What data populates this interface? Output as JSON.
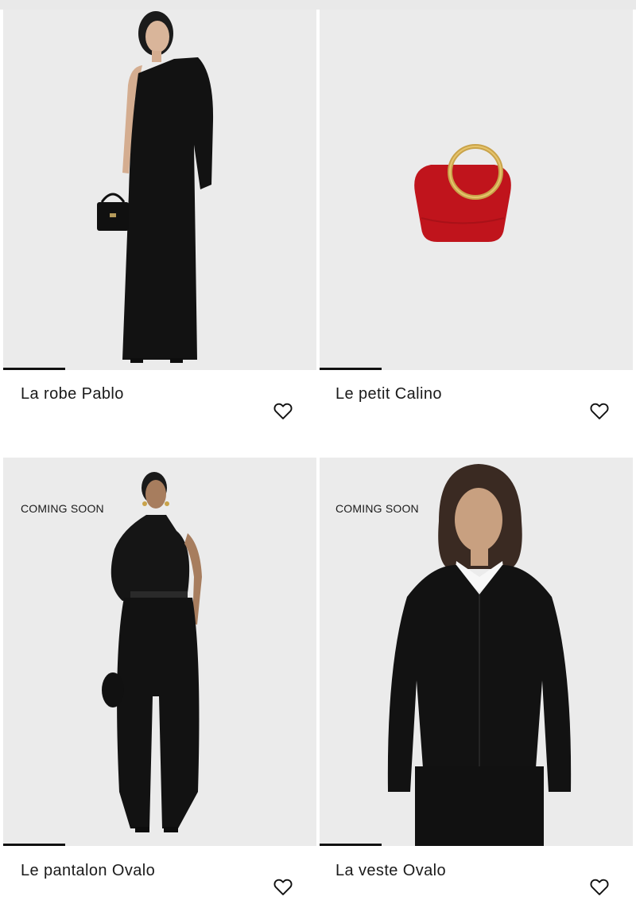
{
  "products": [
    {
      "name": "La robe Pablo",
      "badge": "",
      "image": "model-black-one-shoulder-dress"
    },
    {
      "name": "Le petit Calino",
      "badge": "",
      "image": "red-round-handle-handbag"
    },
    {
      "name": "Le pantalon Ovalo",
      "badge": "COMING SOON",
      "image": "model-black-draped-top-trousers"
    },
    {
      "name": "La veste Ovalo",
      "badge": "COMING SOON",
      "image": "model-black-sculpted-jacket"
    }
  ],
  "icons": {
    "wishlist": "heart-outline-icon"
  },
  "colors": {
    "image_bg": "#ebebeb",
    "accent": "#111111",
    "bag_red": "#c0141c"
  }
}
